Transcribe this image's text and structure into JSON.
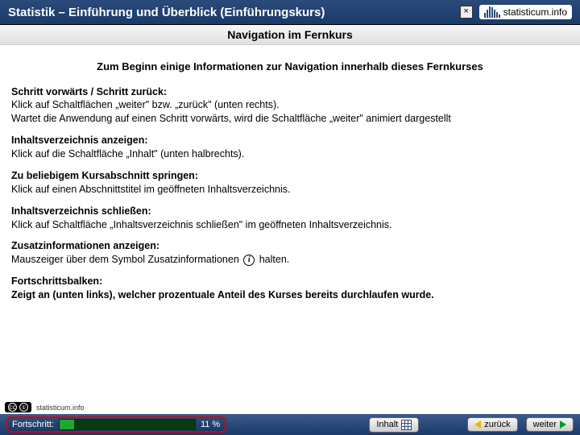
{
  "header": {
    "title": "Statistik – Einführung und Überblick (Einführungskurs)",
    "close": "×",
    "brand": "statisticum.info"
  },
  "subheader": "Navigation im Fernkurs",
  "intro": "Zum Beginn einige Informationen zur Navigation innerhalb dieses Fernkurses",
  "sections": [
    {
      "title": "Schritt vorwärts / Schritt zurück:",
      "body": "Klick auf Schaltflächen „weiter\" bzw. „zurück\" (unten rechts).\nWartet die Anwendung auf einen Schritt vorwärts, wird die Schaltfläche „weiter\" animiert dargestellt"
    },
    {
      "title": "Inhaltsverzeichnis anzeigen:",
      "body": "Klick auf die Schaltfläche „Inhalt\" (unten halbrechts)."
    },
    {
      "title": "Zu beliebigem Kursabschnitt springen:",
      "body": "Klick auf einen Abschnittstitel im geöffneten Inhaltsverzeichnis."
    },
    {
      "title": "Inhaltsverzeichnis schließen:",
      "body": "Klick auf Schaltfläche „Inhaltsverzeichnis schließen\" im geöffneten Inhaltsverzeichnis."
    },
    {
      "title": "Zusatzinformationen anzeigen:",
      "body_pre": "Mauszeiger über dem Symbol Zusatzinformationen ",
      "body_post": " halten."
    },
    {
      "title": "Fortschrittsbalken:",
      "body": "Zeigt an (unten links), welcher prozentuale Anteil des Kurses bereits durchlaufen wurde.",
      "bold_body": true
    }
  ],
  "license": "statisticum.info",
  "footer": {
    "progress_label": "Fortschritt:",
    "progress_pct": 11,
    "progress_pct_text": "11 %",
    "toc": "Inhalt",
    "back": "zurück",
    "next": "weiter"
  }
}
